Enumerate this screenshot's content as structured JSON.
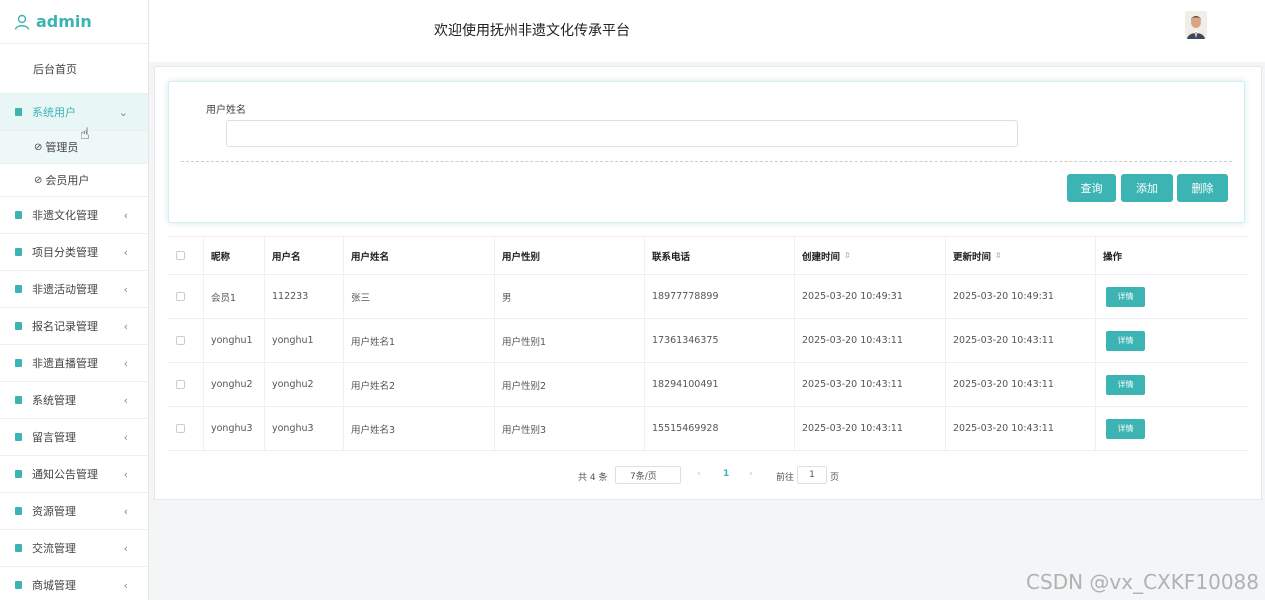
{
  "brand": {
    "name": "admin"
  },
  "sidebar": {
    "home": "后台首页",
    "items": [
      {
        "label": "系统用户",
        "expanded": true,
        "chev": "⌄"
      },
      {
        "label": "非遗文化管理",
        "chev": "‹"
      },
      {
        "label": "项目分类管理",
        "chev": "‹"
      },
      {
        "label": "非遗活动管理",
        "chev": "‹"
      },
      {
        "label": "报名记录管理",
        "chev": "‹"
      },
      {
        "label": "非遗直播管理",
        "chev": "‹"
      },
      {
        "label": "系统管理",
        "chev": "‹"
      },
      {
        "label": "留言管理",
        "chev": "‹"
      },
      {
        "label": "通知公告管理",
        "chev": "‹"
      },
      {
        "label": "资源管理",
        "chev": "‹"
      },
      {
        "label": "交流管理",
        "chev": "‹"
      },
      {
        "label": "商城管理",
        "chev": "‹"
      }
    ],
    "subitems": [
      {
        "label": "管理员"
      },
      {
        "label": "会员用户"
      }
    ]
  },
  "header": {
    "title": "欢迎使用抚州非遗文化传承平台"
  },
  "search": {
    "label": "用户姓名",
    "value": "",
    "buttons": {
      "query": "查询",
      "add": "添加",
      "delete": "删除"
    }
  },
  "table": {
    "columns": [
      "昵称",
      "用户名",
      "用户姓名",
      "用户性别",
      "联系电话",
      "创建时间",
      "更新时间",
      "操作"
    ],
    "sort_icon": "⇳",
    "rows": [
      {
        "nickname": "会员1",
        "username": "112233",
        "realname": "张三",
        "gender": "男",
        "phone": "18977778899",
        "created": "2025-03-20 10:49:31",
        "updated": "2025-03-20 10:49:31",
        "action": "详情"
      },
      {
        "nickname": "yonghu1",
        "username": "yonghu1",
        "realname": "用户姓名1",
        "gender": "用户性别1",
        "phone": "17361346375",
        "created": "2025-03-20 10:43:11",
        "updated": "2025-03-20 10:43:11",
        "action": "详情"
      },
      {
        "nickname": "yonghu2",
        "username": "yonghu2",
        "realname": "用户姓名2",
        "gender": "用户性别2",
        "phone": "18294100491",
        "created": "2025-03-20 10:43:11",
        "updated": "2025-03-20 10:43:11",
        "action": "详情"
      },
      {
        "nickname": "yonghu3",
        "username": "yonghu3",
        "realname": "用户姓名3",
        "gender": "用户性别3",
        "phone": "15515469928",
        "created": "2025-03-20 10:43:11",
        "updated": "2025-03-20 10:43:11",
        "action": "详情"
      }
    ]
  },
  "pagination": {
    "total": "共 4 条",
    "page_size": "7条/页",
    "prev": "‹",
    "current": "1",
    "next": "›",
    "goto_label": "前往",
    "goto_value": "1",
    "goto_unit": "页"
  },
  "watermark": "CSDN @vx_CXKF10088",
  "colors": {
    "accent": "#3cb4b4"
  }
}
